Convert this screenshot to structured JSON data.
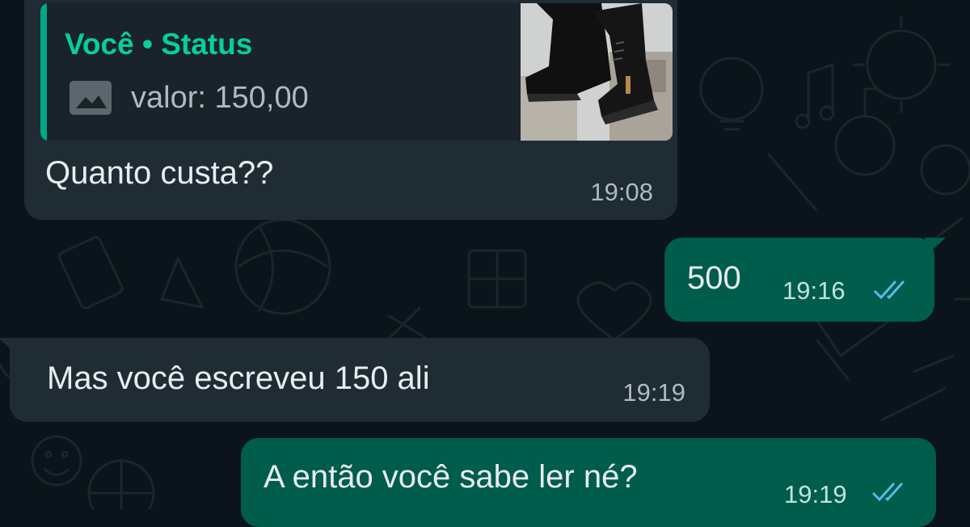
{
  "messages": [
    {
      "direction": "incoming",
      "quote": {
        "author": "Você • Status",
        "text": "valor: 150,00",
        "icon": "image-icon",
        "thumbnail": "black-boots-photo"
      },
      "text": "Quanto custa??",
      "time": "19:08"
    },
    {
      "direction": "outgoing",
      "text": "500",
      "time": "19:16",
      "status": "read"
    },
    {
      "direction": "incoming",
      "text": "Mas você escreveu 150 ali",
      "time": "19:19"
    },
    {
      "direction": "outgoing",
      "text": "A então você sabe ler né?",
      "time": "19:19",
      "status": "read"
    }
  ],
  "colors": {
    "background": "#0b141a",
    "incoming_bubble": "#1f2c34",
    "outgoing_bubble": "#005c4b",
    "accent": "#06cf9c",
    "read_ticks": "#53bdeb"
  }
}
